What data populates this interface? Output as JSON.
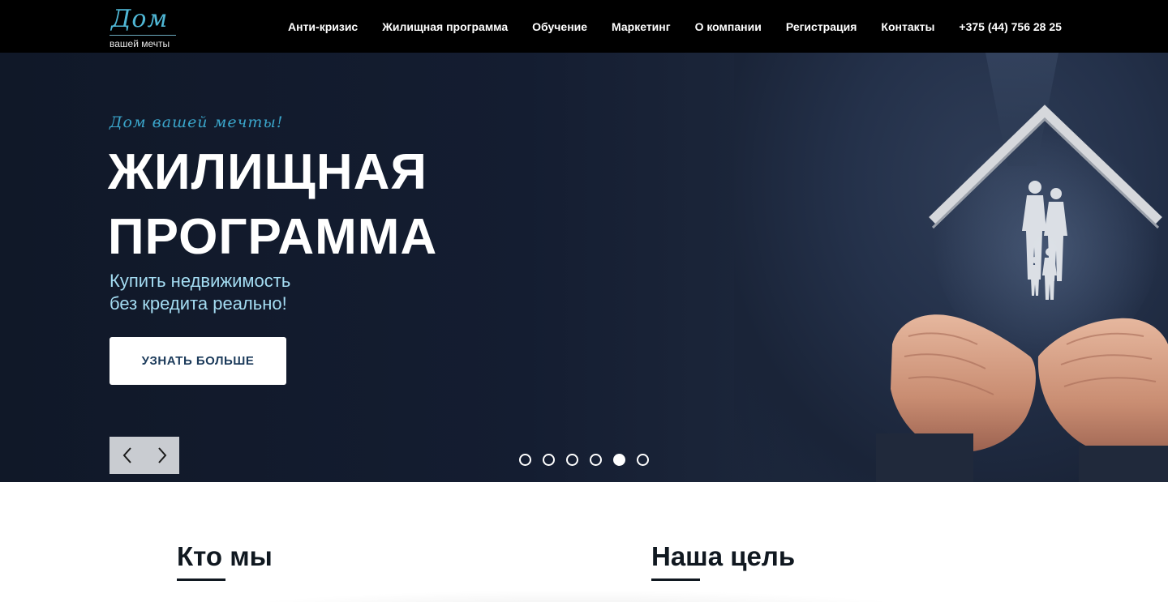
{
  "header": {
    "logo": {
      "script": "Дом",
      "subtitle": "вашей мечты"
    },
    "nav": [
      {
        "label": "Анти-кризис"
      },
      {
        "label": "Жилищная программа"
      },
      {
        "label": "Обучение"
      },
      {
        "label": "Маркетинг"
      },
      {
        "label": "О компании"
      },
      {
        "label": "Регистрация"
      },
      {
        "label": "Контакты"
      },
      {
        "label": "+375 (44) 756 28 25"
      }
    ]
  },
  "hero": {
    "tagline": "Дом вашей мечты!",
    "title_line1": "ЖИЛИЩНАЯ",
    "title_line2": "ПРОГРАММА",
    "subtitle_line1": "Купить недвижимость",
    "subtitle_line2": "без кредита реально!",
    "cta_label": "УЗНАТЬ БОЛЬШЕ",
    "slider": {
      "total_slides": 6,
      "active_slide": 5
    },
    "icons": {
      "prev": "chevron-left-icon",
      "next": "chevron-right-icon"
    }
  },
  "sections": {
    "who_we_are": {
      "title": "Кто мы"
    },
    "our_goal": {
      "title": "Наша цель"
    }
  },
  "colors": {
    "header_bg": "#000000",
    "hero_bg": "#141d31",
    "accent": "#3aa4c9",
    "subtitle": "#a4dcf2",
    "cta_text": "#1b3a5a",
    "heading": "#101820"
  }
}
